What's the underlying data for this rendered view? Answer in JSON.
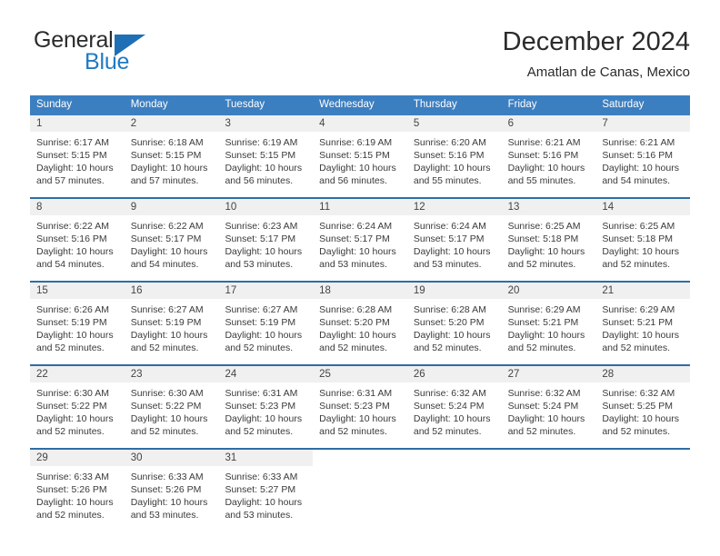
{
  "brand": {
    "name_part1": "General",
    "name_part2": "Blue",
    "triangle_color": "#1f6fb5",
    "blue_color": "#1f7ac4"
  },
  "header": {
    "title": "December 2024",
    "subtitle": "Amatlan de Canas, Mexico"
  },
  "theme": {
    "header_bg": "#3c7fc1",
    "row_border": "#2e6da4",
    "day_band_bg": "#f0f0f0",
    "text": "#333333"
  },
  "weekdays": [
    "Sunday",
    "Monday",
    "Tuesday",
    "Wednesday",
    "Thursday",
    "Friday",
    "Saturday"
  ],
  "weeks": [
    [
      {
        "day": "1",
        "sunrise": "Sunrise: 6:17 AM",
        "sunset": "Sunset: 5:15 PM",
        "daylight1": "Daylight: 10 hours",
        "daylight2": "and 57 minutes."
      },
      {
        "day": "2",
        "sunrise": "Sunrise: 6:18 AM",
        "sunset": "Sunset: 5:15 PM",
        "daylight1": "Daylight: 10 hours",
        "daylight2": "and 57 minutes."
      },
      {
        "day": "3",
        "sunrise": "Sunrise: 6:19 AM",
        "sunset": "Sunset: 5:15 PM",
        "daylight1": "Daylight: 10 hours",
        "daylight2": "and 56 minutes."
      },
      {
        "day": "4",
        "sunrise": "Sunrise: 6:19 AM",
        "sunset": "Sunset: 5:15 PM",
        "daylight1": "Daylight: 10 hours",
        "daylight2": "and 56 minutes."
      },
      {
        "day": "5",
        "sunrise": "Sunrise: 6:20 AM",
        "sunset": "Sunset: 5:16 PM",
        "daylight1": "Daylight: 10 hours",
        "daylight2": "and 55 minutes."
      },
      {
        "day": "6",
        "sunrise": "Sunrise: 6:21 AM",
        "sunset": "Sunset: 5:16 PM",
        "daylight1": "Daylight: 10 hours",
        "daylight2": "and 55 minutes."
      },
      {
        "day": "7",
        "sunrise": "Sunrise: 6:21 AM",
        "sunset": "Sunset: 5:16 PM",
        "daylight1": "Daylight: 10 hours",
        "daylight2": "and 54 minutes."
      }
    ],
    [
      {
        "day": "8",
        "sunrise": "Sunrise: 6:22 AM",
        "sunset": "Sunset: 5:16 PM",
        "daylight1": "Daylight: 10 hours",
        "daylight2": "and 54 minutes."
      },
      {
        "day": "9",
        "sunrise": "Sunrise: 6:22 AM",
        "sunset": "Sunset: 5:17 PM",
        "daylight1": "Daylight: 10 hours",
        "daylight2": "and 54 minutes."
      },
      {
        "day": "10",
        "sunrise": "Sunrise: 6:23 AM",
        "sunset": "Sunset: 5:17 PM",
        "daylight1": "Daylight: 10 hours",
        "daylight2": "and 53 minutes."
      },
      {
        "day": "11",
        "sunrise": "Sunrise: 6:24 AM",
        "sunset": "Sunset: 5:17 PM",
        "daylight1": "Daylight: 10 hours",
        "daylight2": "and 53 minutes."
      },
      {
        "day": "12",
        "sunrise": "Sunrise: 6:24 AM",
        "sunset": "Sunset: 5:17 PM",
        "daylight1": "Daylight: 10 hours",
        "daylight2": "and 53 minutes."
      },
      {
        "day": "13",
        "sunrise": "Sunrise: 6:25 AM",
        "sunset": "Sunset: 5:18 PM",
        "daylight1": "Daylight: 10 hours",
        "daylight2": "and 52 minutes."
      },
      {
        "day": "14",
        "sunrise": "Sunrise: 6:25 AM",
        "sunset": "Sunset: 5:18 PM",
        "daylight1": "Daylight: 10 hours",
        "daylight2": "and 52 minutes."
      }
    ],
    [
      {
        "day": "15",
        "sunrise": "Sunrise: 6:26 AM",
        "sunset": "Sunset: 5:19 PM",
        "daylight1": "Daylight: 10 hours",
        "daylight2": "and 52 minutes."
      },
      {
        "day": "16",
        "sunrise": "Sunrise: 6:27 AM",
        "sunset": "Sunset: 5:19 PM",
        "daylight1": "Daylight: 10 hours",
        "daylight2": "and 52 minutes."
      },
      {
        "day": "17",
        "sunrise": "Sunrise: 6:27 AM",
        "sunset": "Sunset: 5:19 PM",
        "daylight1": "Daylight: 10 hours",
        "daylight2": "and 52 minutes."
      },
      {
        "day": "18",
        "sunrise": "Sunrise: 6:28 AM",
        "sunset": "Sunset: 5:20 PM",
        "daylight1": "Daylight: 10 hours",
        "daylight2": "and 52 minutes."
      },
      {
        "day": "19",
        "sunrise": "Sunrise: 6:28 AM",
        "sunset": "Sunset: 5:20 PM",
        "daylight1": "Daylight: 10 hours",
        "daylight2": "and 52 minutes."
      },
      {
        "day": "20",
        "sunrise": "Sunrise: 6:29 AM",
        "sunset": "Sunset: 5:21 PM",
        "daylight1": "Daylight: 10 hours",
        "daylight2": "and 52 minutes."
      },
      {
        "day": "21",
        "sunrise": "Sunrise: 6:29 AM",
        "sunset": "Sunset: 5:21 PM",
        "daylight1": "Daylight: 10 hours",
        "daylight2": "and 52 minutes."
      }
    ],
    [
      {
        "day": "22",
        "sunrise": "Sunrise: 6:30 AM",
        "sunset": "Sunset: 5:22 PM",
        "daylight1": "Daylight: 10 hours",
        "daylight2": "and 52 minutes."
      },
      {
        "day": "23",
        "sunrise": "Sunrise: 6:30 AM",
        "sunset": "Sunset: 5:22 PM",
        "daylight1": "Daylight: 10 hours",
        "daylight2": "and 52 minutes."
      },
      {
        "day": "24",
        "sunrise": "Sunrise: 6:31 AM",
        "sunset": "Sunset: 5:23 PM",
        "daylight1": "Daylight: 10 hours",
        "daylight2": "and 52 minutes."
      },
      {
        "day": "25",
        "sunrise": "Sunrise: 6:31 AM",
        "sunset": "Sunset: 5:23 PM",
        "daylight1": "Daylight: 10 hours",
        "daylight2": "and 52 minutes."
      },
      {
        "day": "26",
        "sunrise": "Sunrise: 6:32 AM",
        "sunset": "Sunset: 5:24 PM",
        "daylight1": "Daylight: 10 hours",
        "daylight2": "and 52 minutes."
      },
      {
        "day": "27",
        "sunrise": "Sunrise: 6:32 AM",
        "sunset": "Sunset: 5:24 PM",
        "daylight1": "Daylight: 10 hours",
        "daylight2": "and 52 minutes."
      },
      {
        "day": "28",
        "sunrise": "Sunrise: 6:32 AM",
        "sunset": "Sunset: 5:25 PM",
        "daylight1": "Daylight: 10 hours",
        "daylight2": "and 52 minutes."
      }
    ],
    [
      {
        "day": "29",
        "sunrise": "Sunrise: 6:33 AM",
        "sunset": "Sunset: 5:26 PM",
        "daylight1": "Daylight: 10 hours",
        "daylight2": "and 52 minutes."
      },
      {
        "day": "30",
        "sunrise": "Sunrise: 6:33 AM",
        "sunset": "Sunset: 5:26 PM",
        "daylight1": "Daylight: 10 hours",
        "daylight2": "and 53 minutes."
      },
      {
        "day": "31",
        "sunrise": "Sunrise: 6:33 AM",
        "sunset": "Sunset: 5:27 PM",
        "daylight1": "Daylight: 10 hours",
        "daylight2": "and 53 minutes."
      },
      {
        "day": "",
        "sunrise": "",
        "sunset": "",
        "daylight1": "",
        "daylight2": "",
        "empty": true
      },
      {
        "day": "",
        "sunrise": "",
        "sunset": "",
        "daylight1": "",
        "daylight2": "",
        "empty": true
      },
      {
        "day": "",
        "sunrise": "",
        "sunset": "",
        "daylight1": "",
        "daylight2": "",
        "empty": true
      },
      {
        "day": "",
        "sunrise": "",
        "sunset": "",
        "daylight1": "",
        "daylight2": "",
        "empty": true
      }
    ]
  ]
}
